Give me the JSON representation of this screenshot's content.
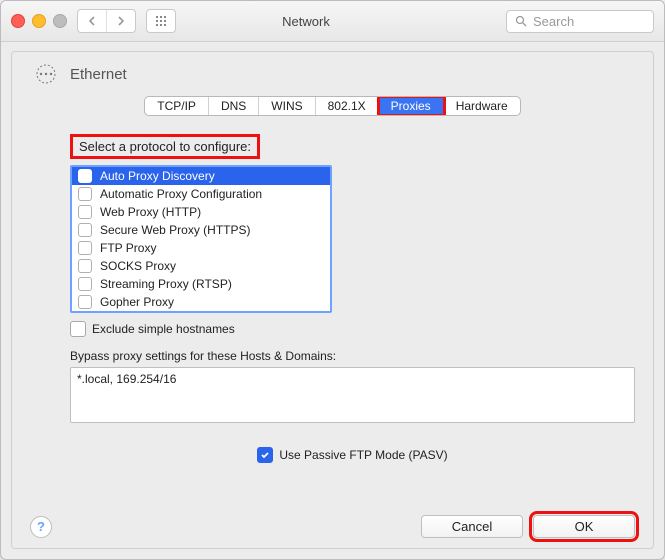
{
  "window": {
    "title": "Network"
  },
  "toolbar": {
    "search_placeholder": "Search"
  },
  "interface": {
    "name": "Ethernet"
  },
  "tabs": {
    "tcpip": "TCP/IP",
    "dns": "DNS",
    "wins": "WINS",
    "dot1x": "802.1X",
    "proxies": "Proxies",
    "hardware": "Hardware",
    "active": "proxies"
  },
  "proxies": {
    "select_label": "Select a protocol to configure:",
    "items": [
      {
        "label": "Auto Proxy Discovery",
        "checked": false,
        "selected": true
      },
      {
        "label": "Automatic Proxy Configuration",
        "checked": false,
        "selected": false
      },
      {
        "label": "Web Proxy (HTTP)",
        "checked": false,
        "selected": false
      },
      {
        "label": "Secure Web Proxy (HTTPS)",
        "checked": false,
        "selected": false
      },
      {
        "label": "FTP Proxy",
        "checked": false,
        "selected": false
      },
      {
        "label": "SOCKS Proxy",
        "checked": false,
        "selected": false
      },
      {
        "label": "Streaming Proxy (RTSP)",
        "checked": false,
        "selected": false
      },
      {
        "label": "Gopher Proxy",
        "checked": false,
        "selected": false
      }
    ],
    "exclude_simple_label": "Exclude simple hostnames",
    "exclude_simple_checked": false,
    "bypass_label": "Bypass proxy settings for these Hosts & Domains:",
    "bypass_value": "*.local, 169.254/16",
    "passive_label": "Use Passive FTP Mode (PASV)",
    "passive_checked": true
  },
  "buttons": {
    "cancel": "Cancel",
    "ok": "OK"
  },
  "annotations": {
    "highlight_tab": "proxies",
    "highlight_section_head": true,
    "highlight_ok": true
  }
}
